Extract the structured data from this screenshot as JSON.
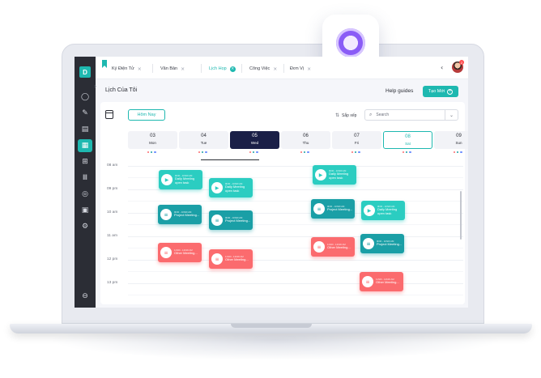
{
  "tabs": [
    {
      "label": "Ký Điện Tử",
      "active": false
    },
    {
      "label": "Văn Bản",
      "active": false
    },
    {
      "label": "Lịch Họp",
      "active": true
    },
    {
      "label": "Công Việc",
      "active": false
    },
    {
      "label": "Đơn Vị",
      "active": false
    }
  ],
  "logo_letter": "D",
  "avatar_badge": "2",
  "header": {
    "title": "Lịch Của Tôi",
    "help": "Help guides",
    "create_label": "Tạo Mới"
  },
  "toolbar": {
    "today_label": "Hôm Nay",
    "sort_label": "Sắp xếp",
    "search_placeholder": "Search"
  },
  "days": [
    {
      "num": "03",
      "name": "Mon",
      "state": "normal"
    },
    {
      "num": "04",
      "name": "Tue",
      "state": "normal"
    },
    {
      "num": "05",
      "name": "Wed",
      "state": "selected"
    },
    {
      "num": "06",
      "name": "Thu",
      "state": "normal"
    },
    {
      "num": "07",
      "name": "Fri",
      "state": "normal"
    },
    {
      "num": "08",
      "name": "Sat",
      "state": "today"
    },
    {
      "num": "09",
      "name": "Sun",
      "state": "normal"
    }
  ],
  "dot_colors": [
    "#fb6b6e",
    "#1a9fa6",
    "#6a8cff"
  ],
  "times": [
    "08 am",
    "09 pm",
    "10 am",
    "11 am",
    "12 pm",
    "13 pm"
  ],
  "events": [
    {
      "time": "9h00 - 10h00 AM",
      "title": "Daily Meeting open task",
      "color": "teal",
      "icon": "video"
    },
    {
      "time": "9h00 - 10h00 AM",
      "title": "Daily Meeting open task",
      "color": "teal",
      "icon": "video"
    },
    {
      "time": "9h00 - 10h00 AM",
      "title": "Daily Meeting open task",
      "color": "teal",
      "icon": "video"
    },
    {
      "time": "9h00 - 10h00 AM",
      "title": "Daily Meeting open task",
      "color": "teal",
      "icon": "video"
    },
    {
      "time": "9h00 - 10h00 AM",
      "title": "Project Meeting...",
      "color": "dteal",
      "icon": "list"
    },
    {
      "time": "9h00 - 10h00 AM",
      "title": "Project Meeting...",
      "color": "dteal",
      "icon": "list"
    },
    {
      "time": "9h00 - 10h00 AM",
      "title": "Project Meeting...",
      "color": "dteal",
      "icon": "list"
    },
    {
      "time": "9h00 - 10h00 AM",
      "title": "Project Meeting...",
      "color": "dteal",
      "icon": "list"
    },
    {
      "time": "11h00 - 12h00 AM",
      "title": "Other Meeting...",
      "color": "red",
      "icon": "list"
    },
    {
      "time": "11h00 - 12h00 AM",
      "title": "Other Meeting...",
      "color": "red",
      "icon": "list"
    },
    {
      "time": "11h00 - 12h00 AM",
      "title": "Other Meeting...",
      "color": "red",
      "icon": "list"
    },
    {
      "time": "11h00 - 12h00 AM",
      "title": "Other Meeting...",
      "color": "red",
      "icon": "list"
    }
  ]
}
